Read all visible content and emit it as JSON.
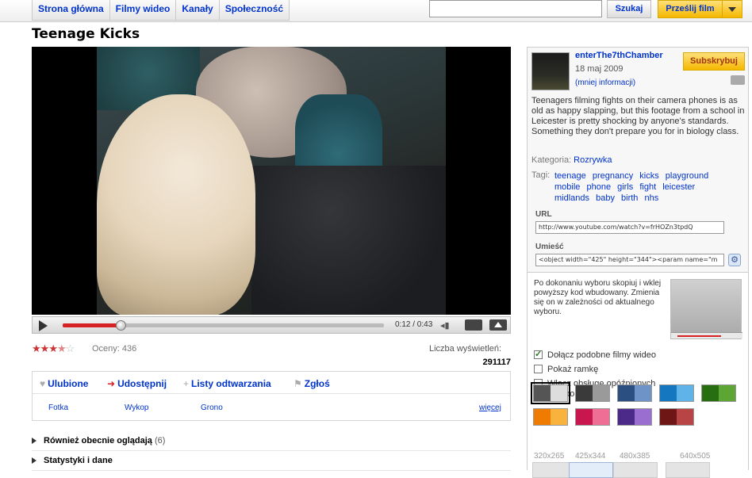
{
  "nav": {
    "tabs": [
      "Strona główna",
      "Filmy wideo",
      "Kanały",
      "Społeczność"
    ],
    "search_value": "",
    "search_label": "Szukaj",
    "upload_label": "Prześlij film"
  },
  "video": {
    "title": "Teenage Kicks",
    "time_display": "0:12 / 0:43",
    "progress_fraction": 0.18,
    "rating_stars": 3.5,
    "rating_label": "Oceny: 436",
    "views_label": "Liczba wyświetleń:",
    "views_count": "291117"
  },
  "actions": {
    "favorite": "Ulubione",
    "share": "Udostępnij",
    "playlists": "Listy odtwarzania",
    "flag": "Zgłoś",
    "share_links": [
      "Fotka",
      "Wykop",
      "Grono"
    ],
    "more": "więcej"
  },
  "sections": [
    {
      "label": "Również obecnie oglądają",
      "count": "(6)"
    },
    {
      "label": "Statystyki i dane",
      "count": ""
    }
  ],
  "channel": {
    "name": "enterThe7thChamber",
    "date": "18 maj 2009",
    "more_info": "(mniej informacji)",
    "subscribe": "Subskrybuj",
    "description": "Teenagers filming fights on their camera phones is as old as happy slapping, but this footage from a school in Leicester is pretty shocking by anyone's standards. Something they don't prepare you for in biology class.",
    "category_label": "Kategoria:",
    "category": "Rozrywka",
    "tags_label": "Tagi:",
    "tags": [
      "teenage",
      "pregnancy",
      "kicks",
      "playground",
      "mobile",
      "phone",
      "girls",
      "fight",
      "leicester",
      "midlands",
      "baby",
      "birth",
      "nhs"
    ],
    "url_label": "URL",
    "url_value": "http://www.youtube.com/watch?v=frHOZn3tpdQ",
    "embed_label": "Umieść",
    "embed_value": "<object width=\"425\" height=\"344\"><param name=\"m"
  },
  "embed_options": {
    "help": "Po dokonaniu wyboru skopiuj i wklej powyższy kod wbudowany. Zmienia się on w zależności od aktualnego wyboru.",
    "options": [
      {
        "label": "Dołącz podobne filmy wideo",
        "checked": true
      },
      {
        "label": "Pokaż ramkę",
        "checked": false
      },
      {
        "label": "Włącz obsługę opóźnionych plików cookie",
        "checked": false
      }
    ],
    "help_link": "[?]",
    "swatches": [
      [
        "#555555",
        "#dddddd"
      ],
      [
        "#3a3a3a",
        "#9a9a9a"
      ],
      [
        "#2b4f80",
        "#6e93c6"
      ],
      [
        "#1477c0",
        "#5fb3e8"
      ],
      [
        "#276e10",
        "#5ea633"
      ],
      [
        "#ef7b00",
        "#f9b23b"
      ],
      [
        "#c8164e",
        "#ee6e96"
      ],
      [
        "#4b2a8a",
        "#9a6ed0"
      ],
      [
        "#6e1516",
        "#b84446"
      ]
    ],
    "sizes": [
      "320x265",
      "425x344",
      "480x385",
      "640x505"
    ]
  }
}
